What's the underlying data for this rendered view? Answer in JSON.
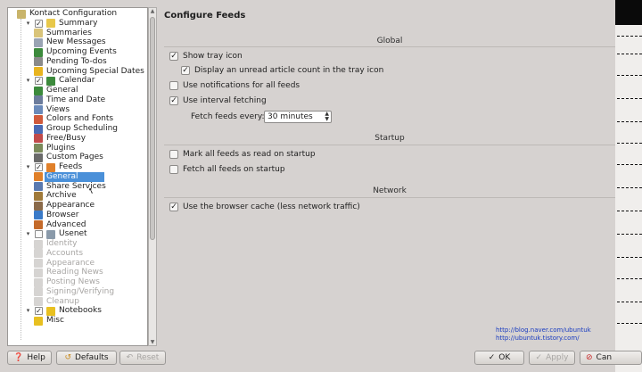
{
  "tree": {
    "rows": [
      {
        "label": "Kontact Configuration",
        "level": 0,
        "expander": "",
        "check": "",
        "icon": "#c9b46a",
        "icon_name": "folder-icon",
        "state": "normal"
      },
      {
        "label": "Summary",
        "level": 1,
        "expander": "▾",
        "check": "✓",
        "icon": "#e8c84a",
        "icon_name": "summary-icon",
        "state": "normal"
      },
      {
        "label": "Summaries",
        "level": 2,
        "expander": "",
        "check": "",
        "icon": "#d9c47a",
        "icon_name": "summaries-icon",
        "state": "normal"
      },
      {
        "label": "New Messages",
        "level": 2,
        "expander": "",
        "check": "",
        "icon": "#9aa4b4",
        "icon_name": "mail-icon",
        "state": "normal"
      },
      {
        "label": "Upcoming Events",
        "level": 2,
        "expander": "",
        "check": "",
        "icon": "#3c8a3c",
        "icon_name": "calendar-icon",
        "state": "normal"
      },
      {
        "label": "Pending To-dos",
        "level": 2,
        "expander": "",
        "check": "",
        "icon": "#8a8a8a",
        "icon_name": "todo-icon",
        "state": "normal"
      },
      {
        "label": "Upcoming Special Dates",
        "level": 2,
        "expander": "",
        "check": "",
        "icon": "#e8b420",
        "icon_name": "special-dates-icon",
        "state": "normal"
      },
      {
        "label": "Calendar",
        "level": 1,
        "expander": "▾",
        "check": "✓",
        "icon": "#3c8a3c",
        "icon_name": "calendar-icon",
        "state": "normal"
      },
      {
        "label": "General",
        "level": 2,
        "expander": "",
        "check": "",
        "icon": "#3c8a3c",
        "icon_name": "general-icon",
        "state": "normal"
      },
      {
        "label": "Time and Date",
        "level": 2,
        "expander": "",
        "check": "",
        "icon": "#6c7c9c",
        "icon_name": "clock-icon",
        "state": "normal"
      },
      {
        "label": "Views",
        "level": 2,
        "expander": "",
        "check": "",
        "icon": "#6a8aba",
        "icon_name": "views-icon",
        "state": "normal"
      },
      {
        "label": "Colors and Fonts",
        "level": 2,
        "expander": "",
        "check": "",
        "icon": "#d05a3c",
        "icon_name": "palette-icon",
        "state": "normal"
      },
      {
        "label": "Group Scheduling",
        "level": 2,
        "expander": "",
        "check": "",
        "icon": "#4a6ab4",
        "icon_name": "group-icon",
        "state": "normal"
      },
      {
        "label": "Free/Busy",
        "level": 2,
        "expander": "",
        "check": "",
        "icon": "#c04a4a",
        "icon_name": "freebusy-icon",
        "state": "normal"
      },
      {
        "label": "Plugins",
        "level": 2,
        "expander": "",
        "check": "",
        "icon": "#7a8a5a",
        "icon_name": "plugin-icon",
        "state": "normal"
      },
      {
        "label": "Custom Pages",
        "level": 2,
        "expander": "",
        "check": "",
        "icon": "#6a6a6a",
        "icon_name": "custom-pages-icon",
        "state": "normal"
      },
      {
        "label": "Feeds",
        "level": 1,
        "expander": "▾",
        "check": "✓",
        "icon": "#e0802a",
        "icon_name": "feeds-icon",
        "state": "normal"
      },
      {
        "label": "General",
        "level": 2,
        "expander": "",
        "check": "",
        "icon": "#e0802a",
        "icon_name": "general-icon",
        "state": "selected"
      },
      {
        "label": "Share Services",
        "level": 2,
        "expander": "",
        "check": "",
        "icon": "#5a7ab0",
        "icon_name": "share-icon",
        "state": "normal"
      },
      {
        "label": "Archive",
        "level": 2,
        "expander": "",
        "check": "",
        "icon": "#a07a3a",
        "icon_name": "archive-icon",
        "state": "normal"
      },
      {
        "label": "Appearance",
        "level": 2,
        "expander": "",
        "check": "",
        "icon": "#8a6a4a",
        "icon_name": "appearance-icon",
        "state": "normal"
      },
      {
        "label": "Browser",
        "level": 2,
        "expander": "",
        "check": "",
        "icon": "#3a7ac8",
        "icon_name": "browser-icon",
        "state": "normal"
      },
      {
        "label": "Advanced",
        "level": 2,
        "expander": "",
        "check": "",
        "icon": "#c46a2a",
        "icon_name": "advanced-icon",
        "state": "normal"
      },
      {
        "label": "Usenet",
        "level": 1,
        "expander": "▾",
        "check": " ",
        "icon": "#8a9aaa",
        "icon_name": "usenet-icon",
        "state": "normal"
      },
      {
        "label": "Identity",
        "level": 2,
        "expander": "",
        "check": "",
        "icon": "#d6d4d2",
        "icon_name": "identity-icon",
        "state": "disabled"
      },
      {
        "label": "Accounts",
        "level": 2,
        "expander": "",
        "check": "",
        "icon": "#d6d4d2",
        "icon_name": "accounts-icon",
        "state": "disabled"
      },
      {
        "label": "Appearance",
        "level": 2,
        "expander": "",
        "check": "",
        "icon": "#d6d4d2",
        "icon_name": "appearance-icon",
        "state": "disabled"
      },
      {
        "label": "Reading News",
        "level": 2,
        "expander": "",
        "check": "",
        "icon": "#d6d4d2",
        "icon_name": "reading-icon",
        "state": "disabled"
      },
      {
        "label": "Posting News",
        "level": 2,
        "expander": "",
        "check": "",
        "icon": "#d6d4d2",
        "icon_name": "posting-icon",
        "state": "disabled"
      },
      {
        "label": "Signing/Verifying",
        "level": 2,
        "expander": "",
        "check": "",
        "icon": "#d6d4d2",
        "icon_name": "signing-icon",
        "state": "disabled"
      },
      {
        "label": "Cleanup",
        "level": 2,
        "expander": "",
        "check": "",
        "icon": "#d6d4d2",
        "icon_name": "cleanup-icon",
        "state": "disabled"
      },
      {
        "label": "Notebooks",
        "level": 1,
        "expander": "▾",
        "check": "✓",
        "icon": "#e8c020",
        "icon_name": "notebooks-icon",
        "state": "normal"
      },
      {
        "label": "Misc",
        "level": 2,
        "expander": "",
        "check": "",
        "icon": "#e8c020",
        "icon_name": "misc-icon",
        "state": "normal"
      }
    ]
  },
  "main": {
    "title": "Configure Feeds",
    "groups": {
      "global": "Global",
      "startup": "Startup",
      "network": "Network"
    },
    "options": {
      "show_tray": {
        "label": "Show tray icon",
        "checked": true
      },
      "unread_count": {
        "label": "Display an unread article count in the tray icon",
        "checked": true
      },
      "notifications": {
        "label": "Use notifications for all feeds",
        "checked": false
      },
      "interval": {
        "label": "Use interval fetching",
        "checked": true
      },
      "mark_read": {
        "label": "Mark all feeds as read on startup",
        "checked": false
      },
      "fetch_startup": {
        "label": "Fetch all feeds on startup",
        "checked": false
      },
      "browser_cache": {
        "label": "Use the browser cache (less network traffic)",
        "checked": true
      }
    },
    "fetch_every": {
      "label": "Fetch feeds every:",
      "value": "30 minutes"
    },
    "urls": [
      "http://blog.naver.com/ubuntuk",
      "http://ubuntuk.tistory.com/"
    ]
  },
  "buttons": {
    "help": "Help",
    "defaults": "Defaults",
    "reset": "Reset",
    "ok": "OK",
    "apply": "Apply",
    "cancel": "Can"
  }
}
